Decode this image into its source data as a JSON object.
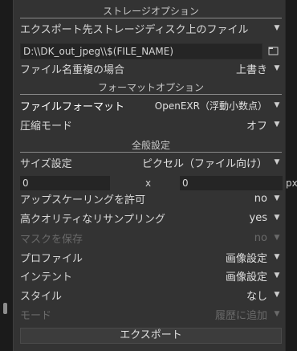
{
  "sections": {
    "storage": "ストレージオプション",
    "format": "フォーマットオプション",
    "global": "全般設定"
  },
  "storage": {
    "target_label": "エクスポート先ストレージディスク上のファイル",
    "path_value": "D:\\\\DK_out_jpeg\\\\$(FILE_NAME)",
    "overwrite_label": "ファイル名重複の場合",
    "overwrite_value": "上書き"
  },
  "format": {
    "file_format_label": "ファイルフォーマット",
    "file_format_value": "OpenEXR（浮動小数点）",
    "compression_label": "圧縮モード",
    "compression_value": "オフ"
  },
  "global": {
    "size_label": "サイズ設定",
    "size_value": "ピクセル（ファイル向け）",
    "width": "0",
    "height": "0",
    "x_sep": "x",
    "unit": "px",
    "upscale_label": "アップスケーリングを許可",
    "upscale_value": "no",
    "hq_label": "高クオリティなリサンプリング",
    "hq_value": "yes",
    "mask_label": "マスクを保存",
    "mask_value": "no",
    "profile_label": "プロファイル",
    "profile_value": "画像設定",
    "intent_label": "インテント",
    "intent_value": "画像設定",
    "style_label": "スタイル",
    "style_value": "なし",
    "mode_label": "モード",
    "mode_value": "履歴に追加"
  },
  "export_button": "エクスポート",
  "icons": {
    "dropdown": "▼"
  }
}
